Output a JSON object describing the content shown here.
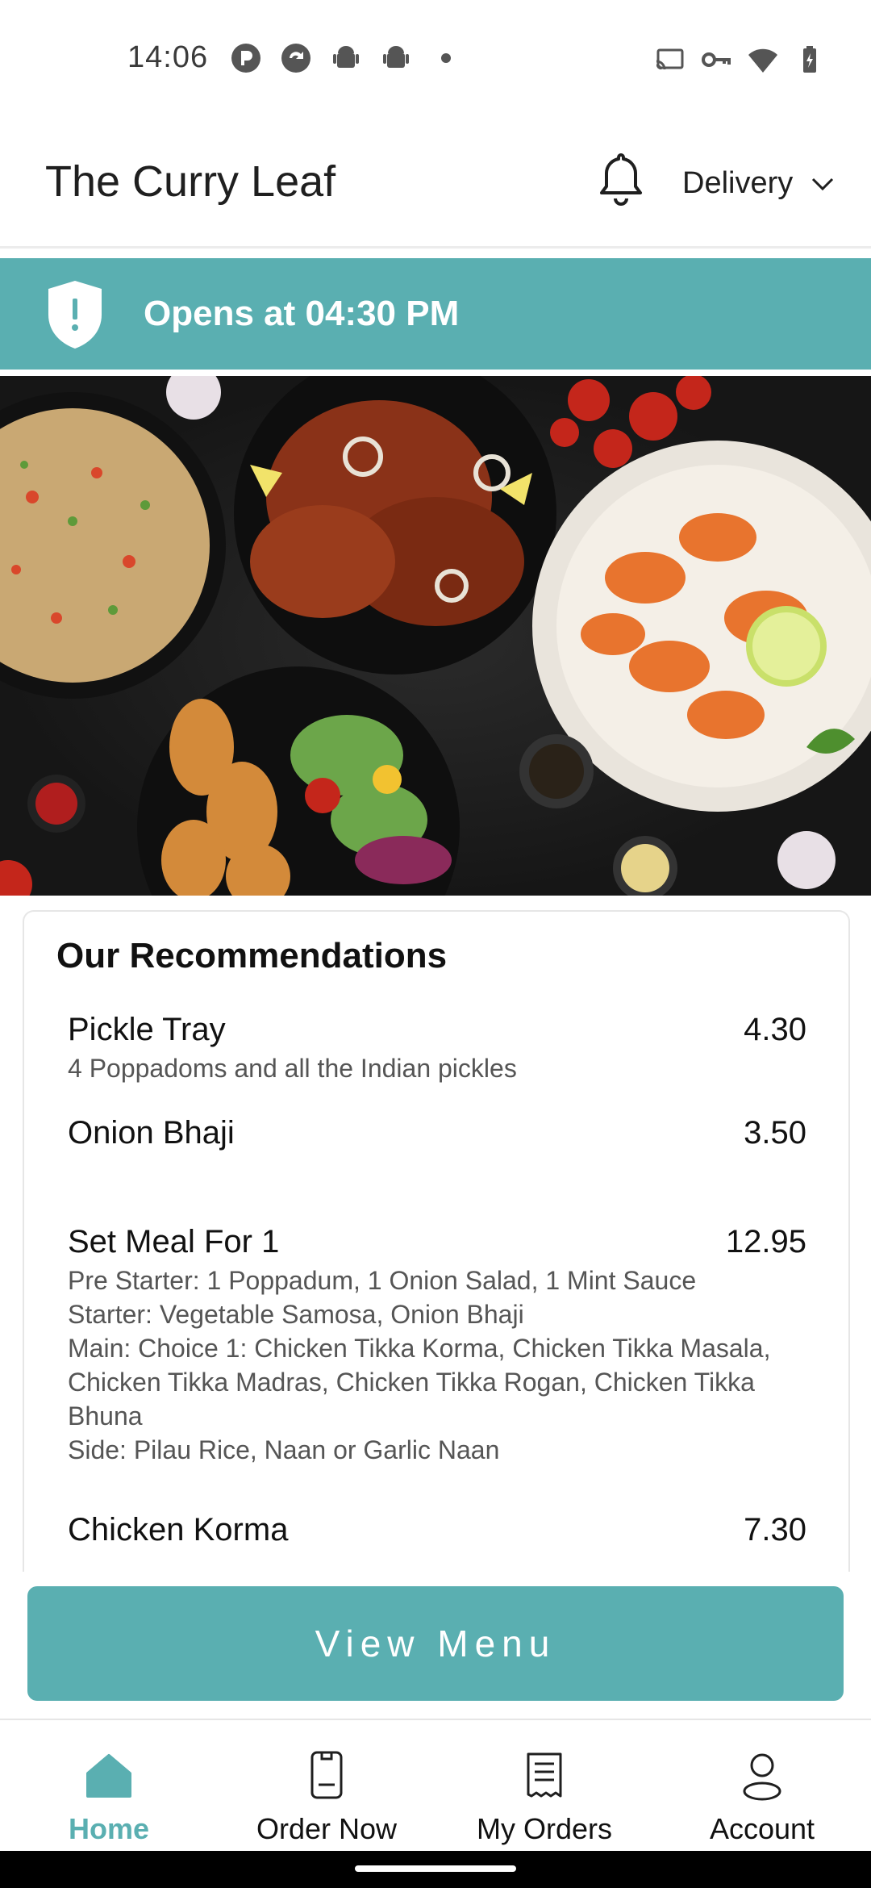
{
  "status_bar": {
    "time": "14:06",
    "left_icons": [
      "app-p-icon",
      "refresh-circle-icon",
      "android-icon",
      "android-icon",
      "dot-icon"
    ],
    "right_icons": [
      "cast-icon",
      "vpn-key-icon",
      "wifi-icon",
      "battery-charging-icon"
    ]
  },
  "header": {
    "title": "The Curry Leaf",
    "bell_icon": "bell-icon",
    "delivery_label": "Delivery",
    "delivery_icon": "chevron-down-icon"
  },
  "banner": {
    "text": "Opens at 04:30 PM",
    "icon": "shield-alert-icon",
    "color": "#5aafb1"
  },
  "hero": {
    "icon": "food-platter-image"
  },
  "recommendations": {
    "title": "Our Recommendations",
    "items": [
      {
        "name": "Pickle Tray",
        "price": "4.30",
        "desc": [
          "4 Poppadoms and all the Indian pickles"
        ]
      },
      {
        "name": "Onion Bhaji",
        "price": "3.50",
        "desc": []
      },
      {
        "name": "Set Meal For 1",
        "price": "12.95",
        "desc": [
          "Pre Starter: 1 Poppadum, 1 Onion Salad, 1 Mint Sauce",
          "Starter: Vegetable Samosa, Onion Bhaji",
          "Main: Choice 1: Chicken Tikka Korma, Chicken Tikka Masala,",
          "Chicken Tikka Madras, Chicken Tikka Rogan, Chicken Tikka",
          "Bhuna",
          "Side: Pilau Rice, Naan or Garlic Naan"
        ]
      },
      {
        "name": "Chicken Korma",
        "price": "7.30",
        "desc": []
      }
    ]
  },
  "view_menu": {
    "label": "View Menu"
  },
  "bottom_nav": {
    "items": [
      {
        "label": "Home",
        "icon": "home-icon",
        "active": true
      },
      {
        "label": "Order Now",
        "icon": "order-icon",
        "active": false
      },
      {
        "label": "My Orders",
        "icon": "receipt-icon",
        "active": false
      },
      {
        "label": "Account",
        "icon": "user-icon",
        "active": false
      }
    ]
  },
  "colors": {
    "accent": "#5aafb1",
    "text": "#111111",
    "muted": "#555555"
  }
}
